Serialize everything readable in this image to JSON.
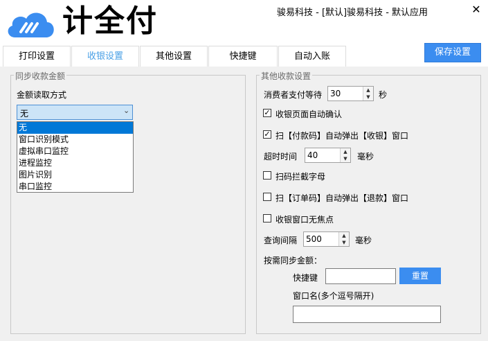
{
  "app": {
    "logo_text": "计全付",
    "window_title": "骏易科技 - [默认]骏易科技 - 默认应用",
    "close_glyph": "✕",
    "save_label": "保存设置"
  },
  "colors": {
    "accent": "#3b8df0",
    "active_tab": "#4aa0e6",
    "selection": "#0078d7"
  },
  "tabs": [
    {
      "label": "打印设置",
      "active": false
    },
    {
      "label": "收银设置",
      "active": true
    },
    {
      "label": "其他设置",
      "active": false
    },
    {
      "label": "快捷键",
      "active": false
    },
    {
      "label": "自动入账",
      "active": false
    }
  ],
  "left_group": {
    "legend": "同步收款金额",
    "read_mode_label": "金额读取方式",
    "combo_value": "无",
    "options": [
      "无",
      "窗口识别模式",
      "虚拟串口监控",
      "进程监控",
      "图片识别",
      "串口监控"
    ]
  },
  "right_group": {
    "legend": "其他收款设置",
    "wait_label": "消费者支付等待",
    "wait_value": "30",
    "wait_unit": "秒",
    "auto_confirm_label": "收银页面自动确认",
    "auto_confirm_checked": true,
    "scan_pay_label": "扫【付款码】自动弹出【收银】窗口",
    "scan_pay_checked": true,
    "timeout_label": "超时时间",
    "timeout_value": "40",
    "timeout_unit": "毫秒",
    "intercept_label": "扫码拦截字母",
    "intercept_checked": false,
    "scan_order_label": "扫【订单码】自动弹出【退款】窗口",
    "scan_order_checked": false,
    "no_focus_label": "收银窗口无焦点",
    "no_focus_checked": false,
    "query_label": "查询间隔",
    "query_value": "500",
    "query_unit": "毫秒",
    "on_demand_label": "按需同步金额：",
    "hotkey_label": "快捷键",
    "hotkey_value": "",
    "reset_label": "重置",
    "window_name_label": "窗口名(多个逗号隔开)",
    "window_name_value": ""
  }
}
